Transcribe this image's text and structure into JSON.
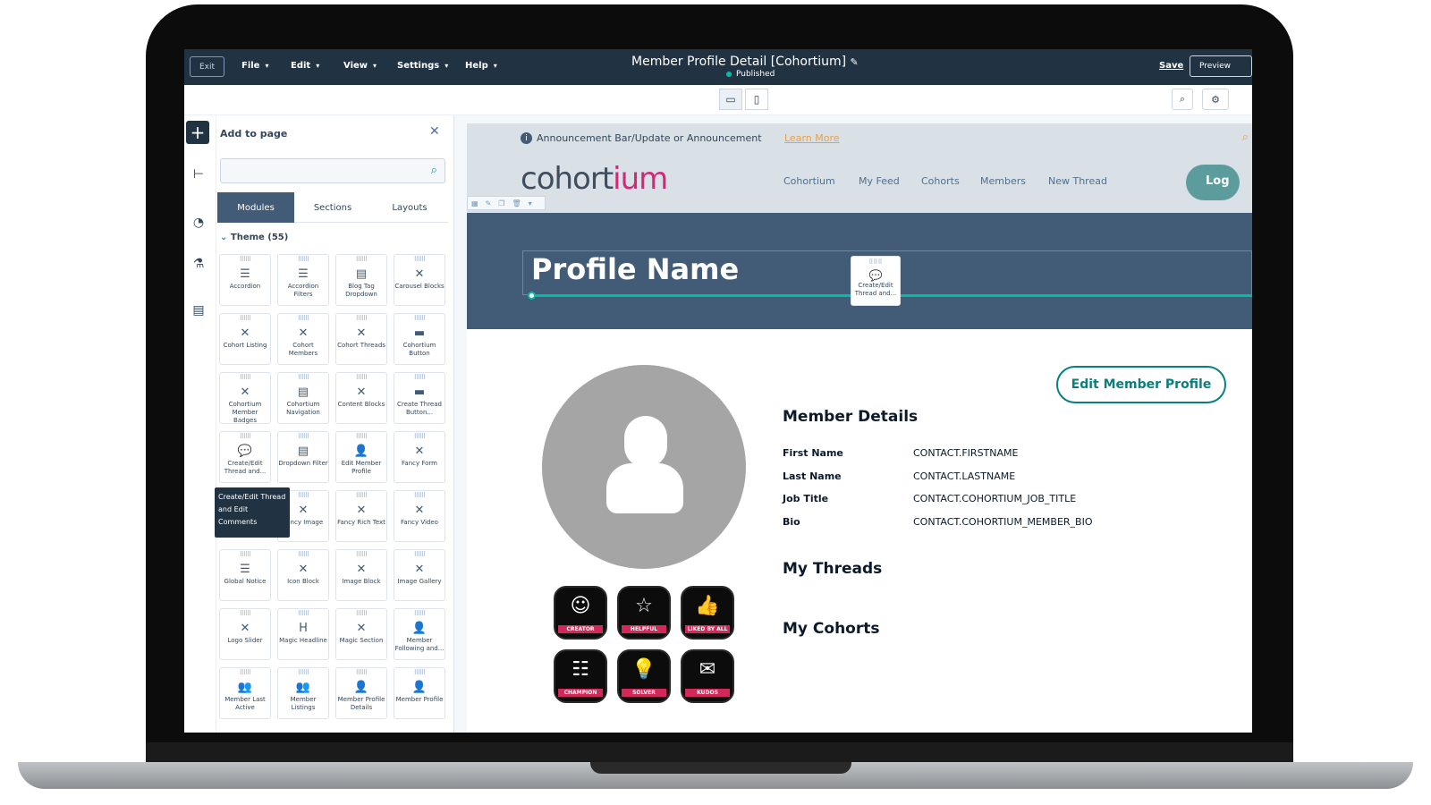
{
  "topbar": {
    "exit": "Exit",
    "menus": [
      "File",
      "Edit",
      "View",
      "Settings",
      "Help"
    ],
    "title": "Member Profile Detail [Cohortium]",
    "status": "Published",
    "save": "Save",
    "preview": "Preview"
  },
  "panel": {
    "title": "Add to page",
    "search_placeholder": "",
    "tabs": [
      "Modules",
      "Sections",
      "Layouts"
    ],
    "theme_label": "Theme (55)",
    "tooltip": "Create/Edit Thread and Edit Comments",
    "modules": [
      {
        "label": "Accordion",
        "icon": "list-icon"
      },
      {
        "label": "Accordion Filters",
        "icon": "list-icon"
      },
      {
        "label": "Blog Tag Dropdown",
        "icon": "dropdown-icon"
      },
      {
        "label": "Carousel Blocks",
        "icon": "x-icon"
      },
      {
        "label": "Cohort Listing",
        "icon": "x-icon"
      },
      {
        "label": "Cohort Members",
        "icon": "x-icon"
      },
      {
        "label": "Cohort Threads",
        "icon": "x-icon"
      },
      {
        "label": "Cohortium Button",
        "icon": "button-icon"
      },
      {
        "label": "Cohortium Member Badges",
        "icon": "x-icon"
      },
      {
        "label": "Cohortium Navigation",
        "icon": "menu-icon"
      },
      {
        "label": "Content Blocks",
        "icon": "x-icon"
      },
      {
        "label": "Create Thread Button...",
        "icon": "button-icon"
      },
      {
        "label": "Create/Edit Thread and...",
        "icon": "comment-icon"
      },
      {
        "label": "Dropdown Filter",
        "icon": "dropdown-icon"
      },
      {
        "label": "Edit Member Profile",
        "icon": "user-edit-icon"
      },
      {
        "label": "Fancy Form",
        "icon": "x-icon"
      },
      {
        "label": "",
        "icon": ""
      },
      {
        "label": "Fancy Image",
        "icon": "x-icon"
      },
      {
        "label": "Fancy Rich Text",
        "icon": "x-icon"
      },
      {
        "label": "Fancy Video",
        "icon": "x-icon"
      },
      {
        "label": "Global Notice",
        "icon": "list-icon"
      },
      {
        "label": "Icon Block",
        "icon": "x-icon"
      },
      {
        "label": "Image Block",
        "icon": "x-icon"
      },
      {
        "label": "Image Gallery",
        "icon": "x-icon"
      },
      {
        "label": "Logo Slider",
        "icon": "x-icon"
      },
      {
        "label": "Magic Headline",
        "icon": "heading-icon"
      },
      {
        "label": "Magic Section",
        "icon": "x-icon"
      },
      {
        "label": "Member Following and...",
        "icon": "user-icon"
      },
      {
        "label": "Member Last Active",
        "icon": "users-icon"
      },
      {
        "label": "Member Listings",
        "icon": "users-icon"
      },
      {
        "label": "Member Profile Details",
        "icon": "user-icon"
      },
      {
        "label": "Member Profile",
        "icon": "user-icon"
      }
    ]
  },
  "page": {
    "announcement": "Announcement Bar/Update or Announcement",
    "learn_more": "Learn More",
    "logo_main": "cohort",
    "logo_accent": "ium",
    "nav": [
      "Cohortium",
      "My Feed",
      "Cohorts",
      "Members",
      "New Thread"
    ],
    "login": "Log",
    "hero_title": "Profile Name",
    "drag_card_label": "Create/Edit Thread and...",
    "edit_profile": "Edit Member Profile",
    "details_heading": "Member Details",
    "details": [
      {
        "label": "First Name",
        "value": "CONTACT.FIRSTNAME"
      },
      {
        "label": "Last Name",
        "value": "CONTACT.LASTNAME"
      },
      {
        "label": "Job Title",
        "value": "CONTACT.COHORTIUM_JOB_TITLE"
      },
      {
        "label": "Bio",
        "value": "CONTACT.COHORTIUM_MEMBER_BIO"
      }
    ],
    "threads_heading": "My Threads",
    "cohorts_heading": "My Cohorts",
    "badges": [
      "CREATOR",
      "HELPFUL",
      "LIKED BY ALL",
      "CHAMPION",
      "SOLVER",
      "KUDOS"
    ]
  },
  "colors": {
    "topbar": "#213343",
    "hero": "#425b76",
    "accent_teal": "#0a7f7f",
    "badge_pink": "#d2285a",
    "logo_pink": "#d2287a"
  }
}
